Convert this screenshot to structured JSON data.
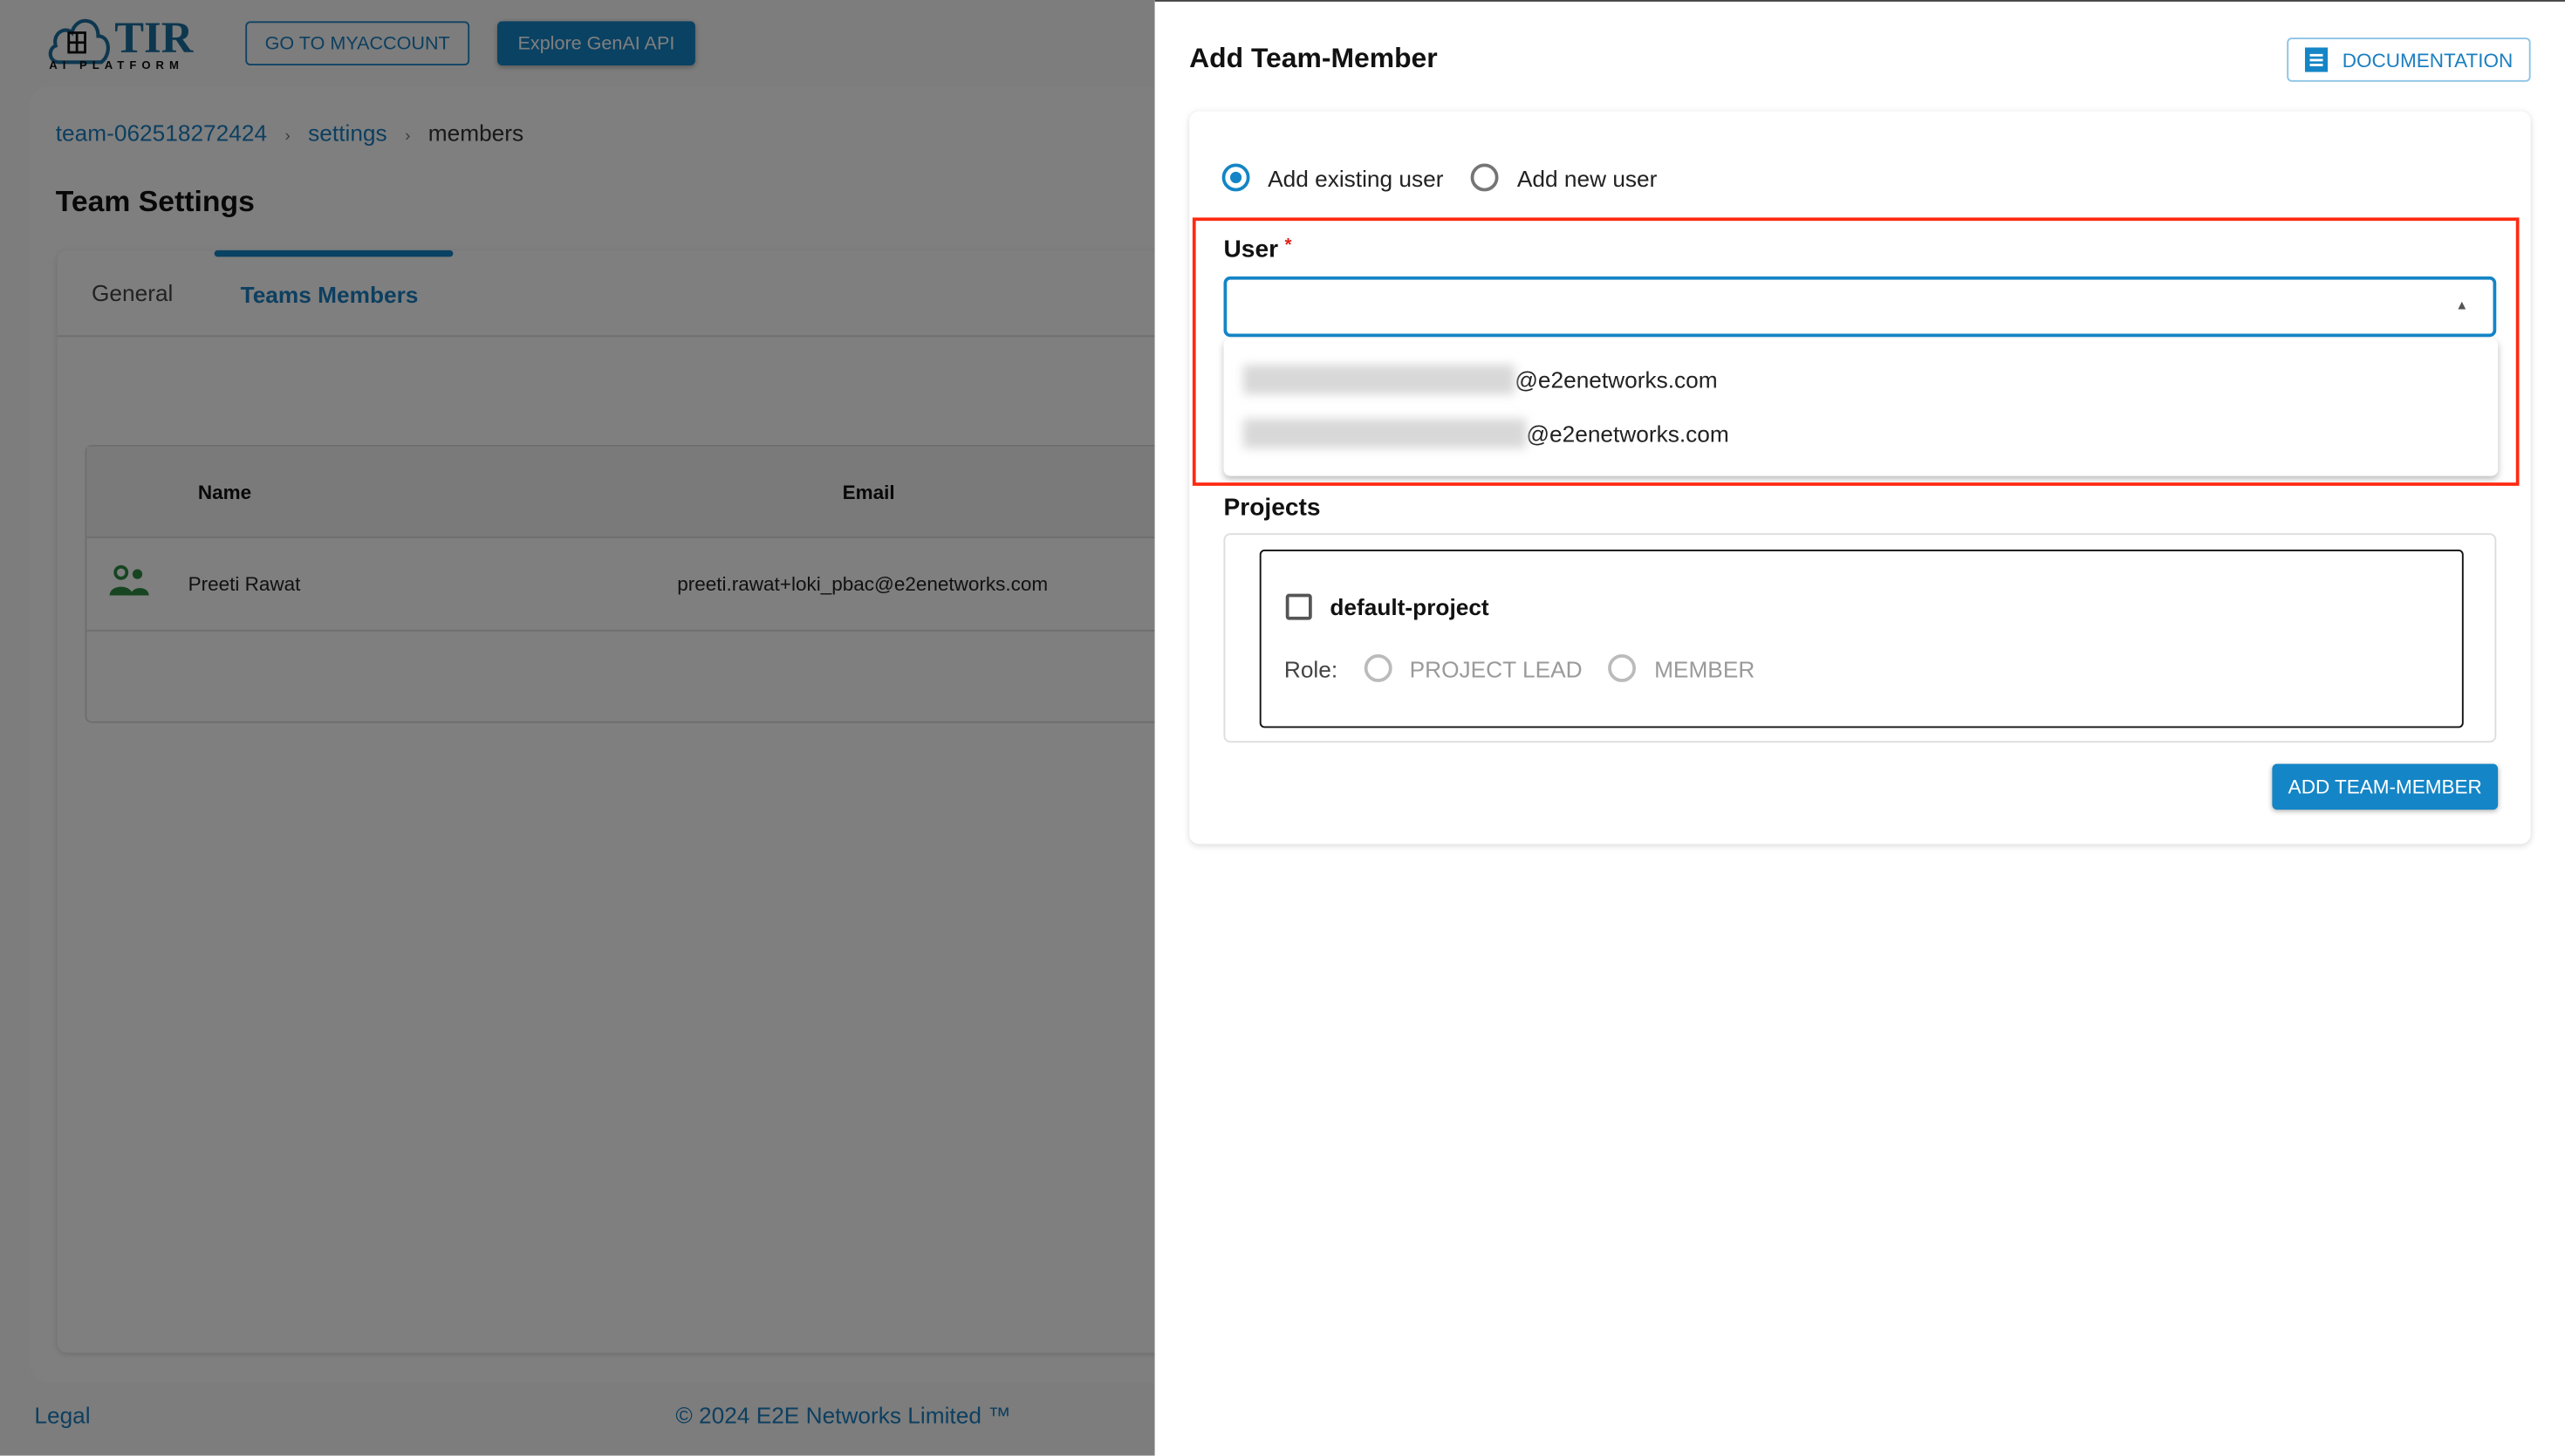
{
  "header": {
    "logo_text": "TIR",
    "logo_sub": "AI PLATFORM",
    "myaccount_label": "GO TO MYACCOUNT",
    "genai_label": "Explore GenAI API"
  },
  "breadcrumb": {
    "team": "team-062518272424",
    "settings": "settings",
    "current": "members"
  },
  "page_title": "Team Settings",
  "tabs": [
    {
      "label": "General",
      "active": false
    },
    {
      "label": "Teams Members",
      "active": true
    }
  ],
  "table": {
    "columns": [
      "Name",
      "Email"
    ],
    "rows": [
      {
        "icon": "people-icon",
        "name": "Preeti Rawat",
        "email": "preeti.rawat+loki_pbac@e2enetworks.com"
      }
    ]
  },
  "footer": {
    "legal": "Legal",
    "copyright": "© 2024 E2E Networks Limited ™"
  },
  "drawer": {
    "title": "Add Team-Member",
    "documentation_label": "DOCUMENTATION",
    "mode_options": [
      {
        "label": "Add existing user",
        "selected": true
      },
      {
        "label": "Add new user",
        "selected": false
      }
    ],
    "user_label": "User",
    "required_mark": "*",
    "user_value": "",
    "user_options": [
      "@e2enetworks.com",
      "@e2enetworks.com"
    ],
    "projects_label": "Projects",
    "project": {
      "name": "default-project",
      "checked": false,
      "role_label": "Role:",
      "roles": [
        "PROJECT LEAD",
        "MEMBER"
      ]
    },
    "submit_label": "ADD TEAM-MEMBER"
  },
  "colors": {
    "accent": "#1485c6",
    "highlight": "#ff2a12",
    "icon_green": "#1e6b2e"
  }
}
